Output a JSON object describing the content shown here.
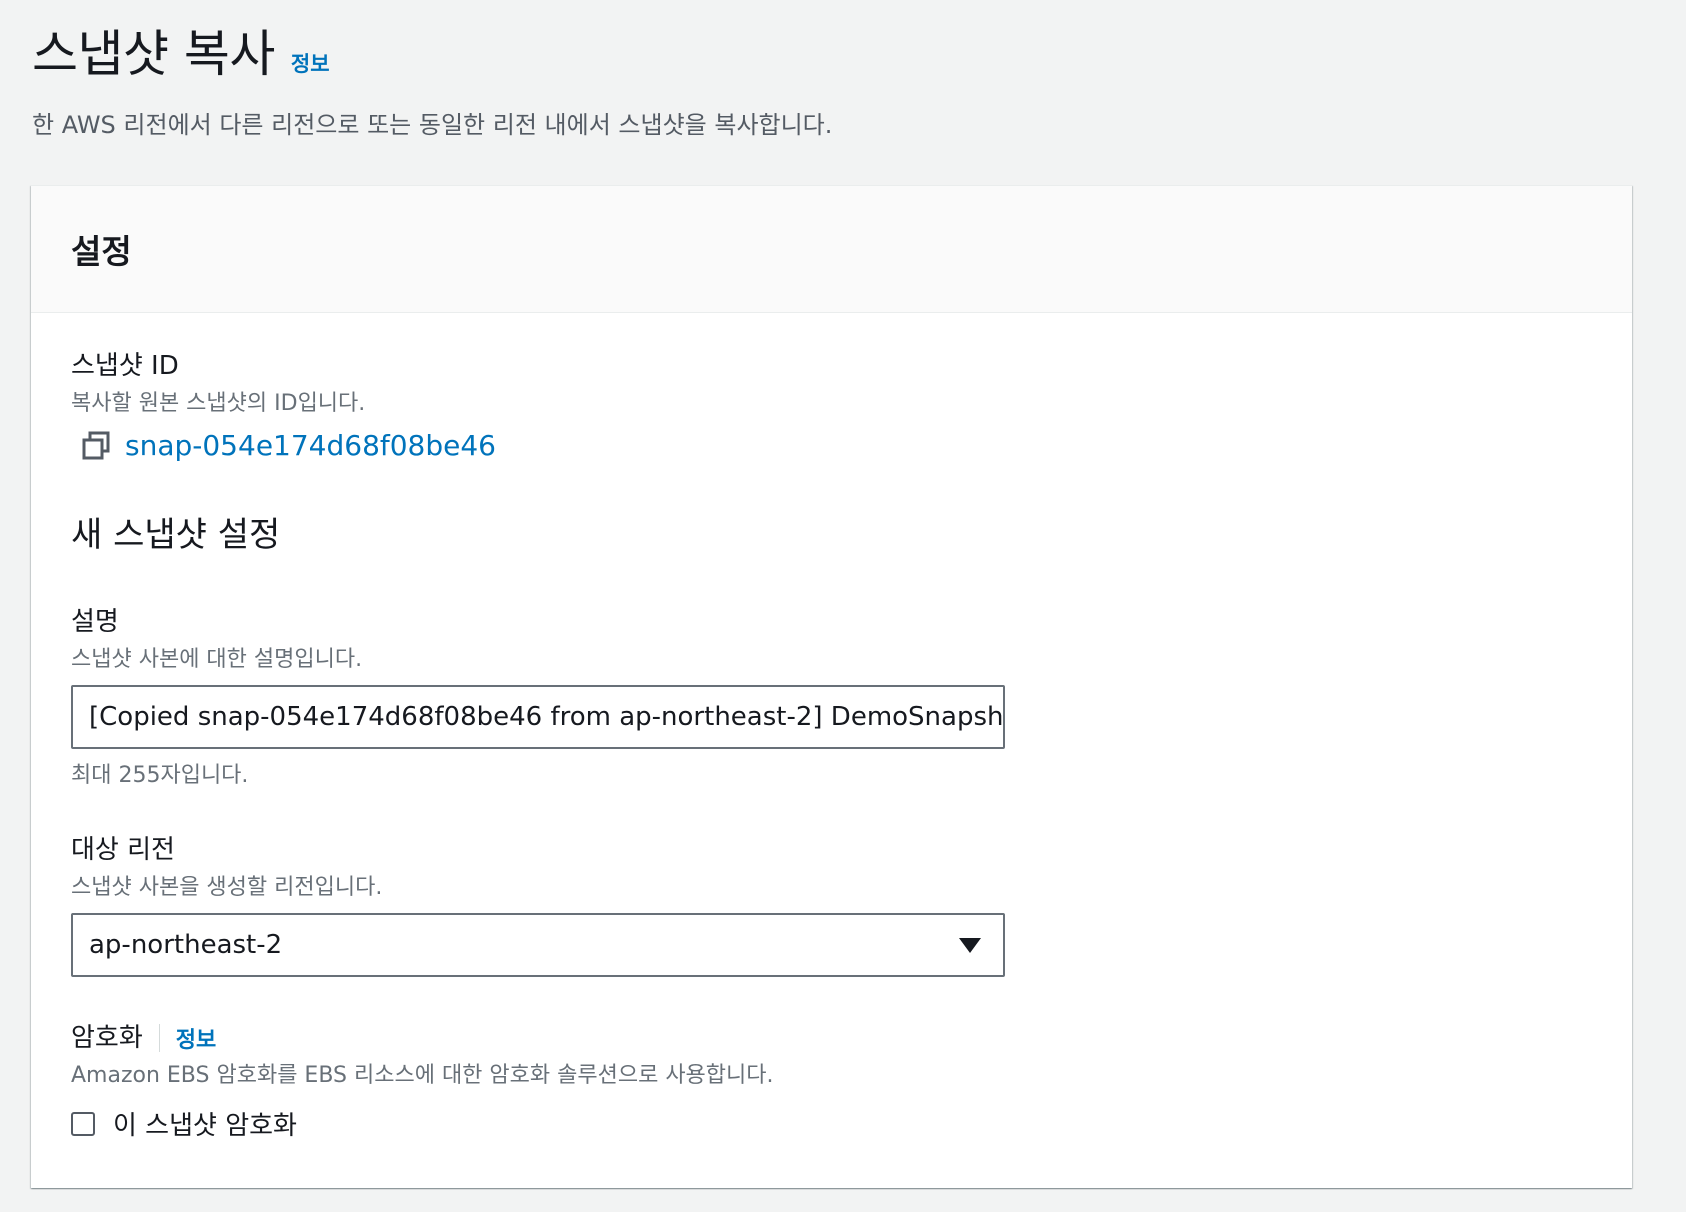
{
  "header": {
    "title": "스냅샷 복사",
    "info_link": "정보",
    "description": "한 AWS 리전에서 다른 리전으로 또는 동일한 리전 내에서 스냅샷을 복사합니다."
  },
  "panel": {
    "title": "설정",
    "snapshot_id": {
      "label": "스냅샷 ID",
      "description": "복사할 원본 스냅샷의 ID입니다.",
      "value": "snap-054e174d68f08be46",
      "icon": "copy-icon"
    },
    "new_snapshot_section_title": "새 스냅샷 설정",
    "description_field": {
      "label": "설명",
      "description": "스냅샷 사본에 대한 설명입니다.",
      "value": "[Copied snap-054e174d68f08be46 from ap-northeast-2] DemoSnapsh",
      "hint": "최대 255자입니다."
    },
    "destination_region": {
      "label": "대상 리전",
      "description": "스냅샷 사본을 생성할 리전입니다.",
      "selected": "ap-northeast-2"
    },
    "encryption": {
      "label": "암호화",
      "info_link": "정보",
      "description": "Amazon EBS 암호화를 EBS 리소스에 대한 암호화 솔루션으로 사용합니다.",
      "checkbox_label": "이 스냅샷 암호화",
      "checked": false
    }
  },
  "colors": {
    "link": "#0073bb",
    "background": "#f2f3f3",
    "text": "#16191f",
    "secondary_text": "#687078"
  }
}
